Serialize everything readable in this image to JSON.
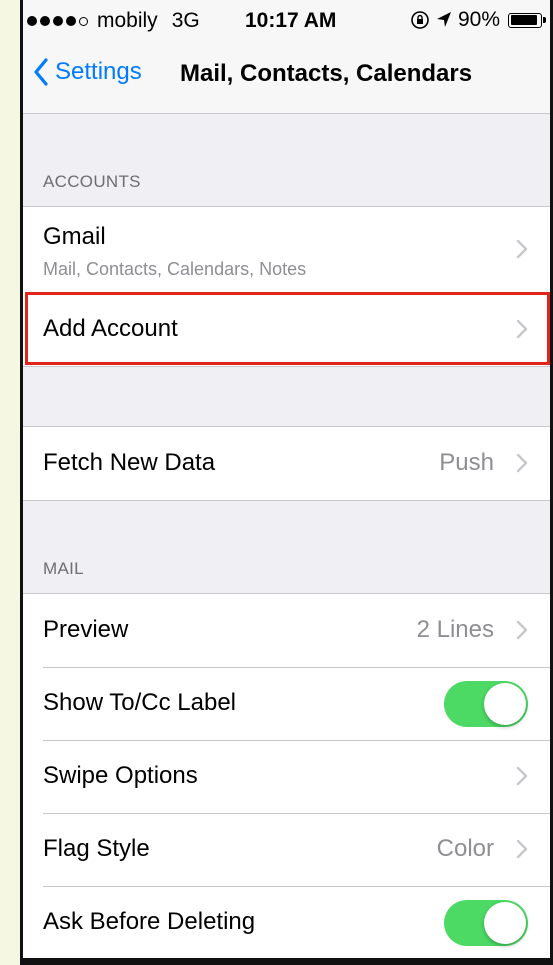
{
  "status_bar": {
    "carrier": "mobily",
    "network": "3G",
    "time": "10:17 AM",
    "battery": "90%",
    "battery_level": 0.9
  },
  "nav": {
    "back_label": "Settings",
    "title": "Mail, Contacts, Calendars"
  },
  "accounts": {
    "header": "ACCOUNTS",
    "gmail_title": "Gmail",
    "gmail_sub": "Mail, Contacts, Calendars, Notes",
    "add_account": "Add Account"
  },
  "fetch": {
    "title": "Fetch New Data",
    "value": "Push"
  },
  "mail": {
    "header": "MAIL",
    "preview_title": "Preview",
    "preview_value": "2 Lines",
    "show_tocc": "Show To/Cc Label",
    "show_tocc_on": true,
    "swipe_options": "Swipe Options",
    "flag_style": "Flag Style",
    "flag_value": "Color",
    "ask_before_deleting": "Ask Before Deleting",
    "ask_before_deleting_on": true
  },
  "colors": {
    "accent": "#007aff",
    "toggle_on": "#4cd964",
    "highlight_border": "#e1251b"
  }
}
